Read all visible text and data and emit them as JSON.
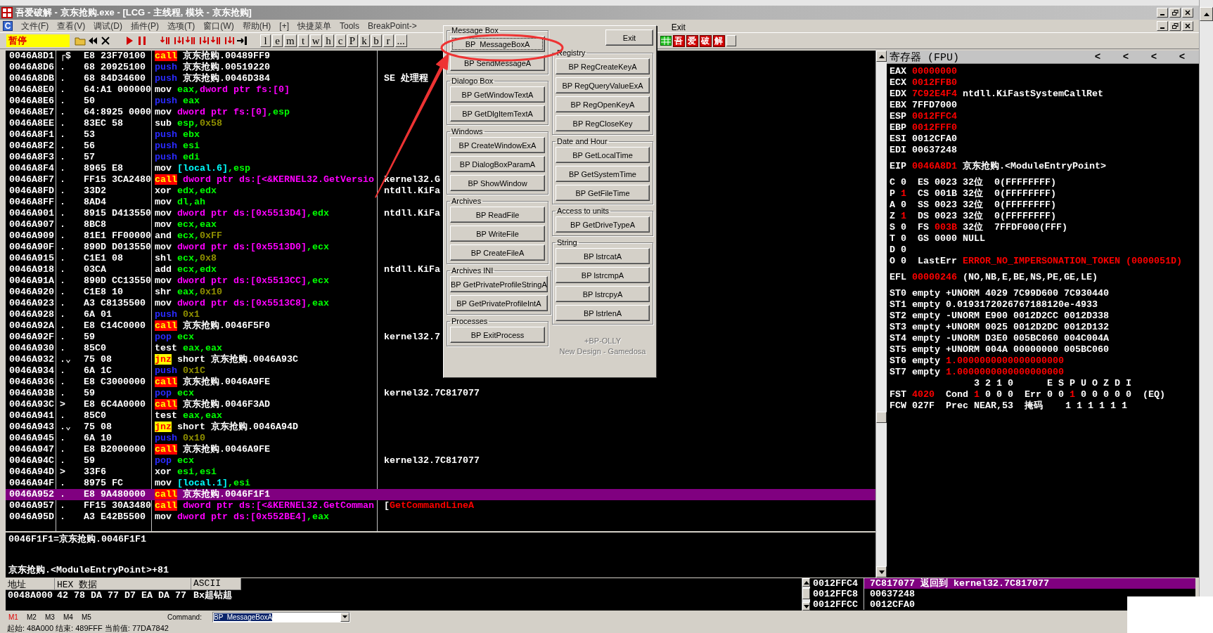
{
  "window": {
    "title": "吾爱破解 - 京东抢购.exe - [LCG - 主线程, 模块 - 京东抢购]"
  },
  "menu": {
    "logo": "C",
    "items": [
      "文件(F)",
      "查看(V)",
      "调试(D)",
      "插件(P)",
      "选项(T)",
      "窗口(W)",
      "帮助(H)",
      "[+]",
      "快捷菜单",
      "Tools",
      "BreakPoint->"
    ],
    "exit": "Exit"
  },
  "toolbar": {
    "state": "暂停",
    "letter_buttons": [
      "l",
      "e",
      "m",
      "t",
      "w",
      "h",
      "c",
      "P",
      "k",
      "b",
      "r",
      "..."
    ],
    "logo_buttons": [
      "吾",
      "爱",
      "破",
      "解"
    ]
  },
  "disassembly": {
    "rows": [
      {
        "address": "0046A8D1",
        "mark": "┌$",
        "bytes": "E8 23F70100",
        "instruction": [
          {
            "text": "call",
            "kind": "call"
          },
          {
            "text": "京东抢购.00489FF9",
            "kind": "sym"
          }
        ],
        "selected": false
      },
      {
        "address": "0046A8D6",
        "mark": ".",
        "bytes": "68 20925100",
        "instruction": [
          {
            "text": "push",
            "kind": "stack"
          },
          {
            "text": "京东抢购.00519220",
            "kind": "sym"
          }
        ],
        "selected": false
      },
      {
        "address": "0046A8DB",
        "mark": ".",
        "bytes": "68 84D34600",
        "instruction": [
          {
            "text": "push",
            "kind": "stack"
          },
          {
            "text": "京东抢购.0046D384",
            "kind": "sym"
          }
        ],
        "comment": [
          {
            "text": "SE 处理程",
            "kind": "text"
          }
        ],
        "selected": false
      },
      {
        "address": "0046A8E0",
        "mark": ".",
        "bytes": "64:A1 000000",
        "instruction": [
          {
            "text": "mov",
            "kind": "op"
          },
          {
            "text": "eax,",
            "kind": "reg"
          },
          {
            "text": "dword ptr fs:[0]",
            "kind": "mem"
          }
        ],
        "selected": false
      },
      {
        "address": "0046A8E6",
        "mark": ".",
        "bytes": "50",
        "instruction": [
          {
            "text": "push",
            "kind": "stack"
          },
          {
            "text": "eax",
            "kind": "reg"
          }
        ],
        "selected": false
      },
      {
        "address": "0046A8E7",
        "mark": ".",
        "bytes": "64:8925 0000",
        "instruction": [
          {
            "text": "mov",
            "kind": "op"
          },
          {
            "text": "dword ptr fs:[0]",
            "kind": "mem"
          },
          {
            "text": ",esp",
            "kind": "reg"
          }
        ],
        "selected": false
      },
      {
        "address": "0046A8EE",
        "mark": ".",
        "bytes": "83EC 58",
        "instruction": [
          {
            "text": "sub",
            "kind": "op"
          },
          {
            "text": "esp,",
            "kind": "reg"
          },
          {
            "text": "0x58",
            "kind": "imm"
          }
        ],
        "selected": false
      },
      {
        "address": "0046A8F1",
        "mark": ".",
        "bytes": "53",
        "instruction": [
          {
            "text": "push",
            "kind": "stack"
          },
          {
            "text": "ebx",
            "kind": "reg"
          }
        ],
        "selected": false
      },
      {
        "address": "0046A8F2",
        "mark": ".",
        "bytes": "56",
        "instruction": [
          {
            "text": "push",
            "kind": "stack"
          },
          {
            "text": "esi",
            "kind": "reg"
          }
        ],
        "selected": false
      },
      {
        "address": "0046A8F3",
        "mark": ".",
        "bytes": "57",
        "instruction": [
          {
            "text": "push",
            "kind": "stack"
          },
          {
            "text": "edi",
            "kind": "reg"
          }
        ],
        "selected": false
      },
      {
        "address": "0046A8F4",
        "mark": ".",
        "bytes": "8965 E8",
        "instruction": [
          {
            "text": "mov",
            "kind": "op"
          },
          {
            "text": "[local.6]",
            "kind": "local"
          },
          {
            "text": ",esp",
            "kind": "reg"
          }
        ],
        "selected": false
      },
      {
        "address": "0046A8F7",
        "mark": ".",
        "bytes": "FF15 3CA2480",
        "instruction": [
          {
            "text": "call",
            "kind": "call"
          },
          {
            "text": "dword ptr ds:[<&KERNEL32.GetVersio",
            "kind": "mem"
          }
        ],
        "comment": [
          {
            "text": "kernel32.G",
            "kind": "text"
          }
        ],
        "selected": false
      },
      {
        "address": "0046A8FD",
        "mark": ".",
        "bytes": "33D2",
        "instruction": [
          {
            "text": "xor",
            "kind": "op"
          },
          {
            "text": "edx,edx",
            "kind": "reg"
          }
        ],
        "comment": [
          {
            "text": "ntdll.KiFa",
            "kind": "text"
          }
        ],
        "selected": false
      },
      {
        "address": "0046A8FF",
        "mark": ".",
        "bytes": "8AD4",
        "instruction": [
          {
            "text": "mov",
            "kind": "op"
          },
          {
            "text": "dl,ah",
            "kind": "reg"
          }
        ],
        "selected": false
      },
      {
        "address": "0046A901",
        "mark": ".",
        "bytes": "8915 D413550",
        "instruction": [
          {
            "text": "mov",
            "kind": "op"
          },
          {
            "text": "dword ptr ds:[0x5513D4]",
            "kind": "mem"
          },
          {
            "text": ",edx",
            "kind": "reg"
          }
        ],
        "comment": [
          {
            "text": "ntdll.KiFa",
            "kind": "text"
          }
        ],
        "selected": false
      },
      {
        "address": "0046A907",
        "mark": ".",
        "bytes": "8BC8",
        "instruction": [
          {
            "text": "mov",
            "kind": "op"
          },
          {
            "text": "ecx,eax",
            "kind": "reg"
          }
        ],
        "selected": false
      },
      {
        "address": "0046A909",
        "mark": ".",
        "bytes": "81E1 FF00000",
        "instruction": [
          {
            "text": "and",
            "kind": "op"
          },
          {
            "text": "ecx,",
            "kind": "reg"
          },
          {
            "text": "0xFF",
            "kind": "imm"
          }
        ],
        "selected": false
      },
      {
        "address": "0046A90F",
        "mark": ".",
        "bytes": "890D D013550",
        "instruction": [
          {
            "text": "mov",
            "kind": "op"
          },
          {
            "text": "dword ptr ds:[0x5513D0]",
            "kind": "mem"
          },
          {
            "text": ",ecx",
            "kind": "reg"
          }
        ],
        "selected": false
      },
      {
        "address": "0046A915",
        "mark": ".",
        "bytes": "C1E1 08",
        "instruction": [
          {
            "text": "shl",
            "kind": "op"
          },
          {
            "text": "ecx,",
            "kind": "reg"
          },
          {
            "text": "0x8",
            "kind": "imm"
          }
        ],
        "selected": false
      },
      {
        "address": "0046A918",
        "mark": ".",
        "bytes": "03CA",
        "instruction": [
          {
            "text": "add",
            "kind": "op"
          },
          {
            "text": "ecx,edx",
            "kind": "reg"
          }
        ],
        "comment": [
          {
            "text": "ntdll.KiFa",
            "kind": "text"
          }
        ],
        "selected": false
      },
      {
        "address": "0046A91A",
        "mark": ".",
        "bytes": "890D CC13550",
        "instruction": [
          {
            "text": "mov",
            "kind": "op"
          },
          {
            "text": "dword ptr ds:[0x5513CC]",
            "kind": "mem"
          },
          {
            "text": ",ecx",
            "kind": "reg"
          }
        ],
        "selected": false
      },
      {
        "address": "0046A920",
        "mark": ".",
        "bytes": "C1E8 10",
        "instruction": [
          {
            "text": "shr",
            "kind": "op"
          },
          {
            "text": "eax,",
            "kind": "reg"
          },
          {
            "text": "0x10",
            "kind": "imm"
          }
        ],
        "selected": false
      },
      {
        "address": "0046A923",
        "mark": ".",
        "bytes": "A3 C8135500",
        "instruction": [
          {
            "text": "mov",
            "kind": "op"
          },
          {
            "text": "dword ptr ds:[0x5513C8]",
            "kind": "mem"
          },
          {
            "text": ",eax",
            "kind": "reg"
          }
        ],
        "selected": false
      },
      {
        "address": "0046A928",
        "mark": ".",
        "bytes": "6A 01",
        "instruction": [
          {
            "text": "push",
            "kind": "stack"
          },
          {
            "text": "0x1",
            "kind": "imm"
          }
        ],
        "selected": false
      },
      {
        "address": "0046A92A",
        "mark": ".",
        "bytes": "E8 C14C0000",
        "instruction": [
          {
            "text": "call",
            "kind": "call"
          },
          {
            "text": "京东抢购.0046F5F0",
            "kind": "sym"
          }
        ],
        "selected": false
      },
      {
        "address": "0046A92F",
        "mark": ".",
        "bytes": "59",
        "instruction": [
          {
            "text": "pop",
            "kind": "stack"
          },
          {
            "text": "ecx",
            "kind": "reg"
          }
        ],
        "comment": [
          {
            "text": "kernel32.7",
            "kind": "text"
          }
        ],
        "selected": false
      },
      {
        "address": "0046A930",
        "mark": ".",
        "bytes": "85C0",
        "instruction": [
          {
            "text": "test",
            "kind": "op"
          },
          {
            "text": "eax,eax",
            "kind": "reg"
          }
        ],
        "selected": false
      },
      {
        "address": "0046A932",
        "mark": ".⌄",
        "bytes": "75 08",
        "instruction": [
          {
            "text": "jnz",
            "kind": "jump"
          },
          {
            "text": "short 京东抢购.0046A93C",
            "kind": "sym"
          }
        ],
        "selected": false
      },
      {
        "address": "0046A934",
        "mark": ".",
        "bytes": "6A 1C",
        "instruction": [
          {
            "text": "push",
            "kind": "stack"
          },
          {
            "text": "0x1C",
            "kind": "imm"
          }
        ],
        "selected": false
      },
      {
        "address": "0046A936",
        "mark": ".",
        "bytes": "E8 C3000000",
        "instruction": [
          {
            "text": "call",
            "kind": "call"
          },
          {
            "text": "京东抢购.0046A9FE",
            "kind": "sym"
          }
        ],
        "selected": false
      },
      {
        "address": "0046A93B",
        "mark": ".",
        "bytes": "59",
        "instruction": [
          {
            "text": "pop",
            "kind": "stack"
          },
          {
            "text": "ecx",
            "kind": "reg"
          }
        ],
        "comment": [
          {
            "text": "kernel32.7C817077",
            "kind": "text"
          }
        ],
        "selected": false
      },
      {
        "address": "0046A93C",
        "mark": ">",
        "bytes": "E8 6C4A0000",
        "instruction": [
          {
            "text": "call",
            "kind": "call"
          },
          {
            "text": "京东抢购.0046F3AD",
            "kind": "sym"
          }
        ],
        "selected": false
      },
      {
        "address": "0046A941",
        "mark": ".",
        "bytes": "85C0",
        "instruction": [
          {
            "text": "test",
            "kind": "op"
          },
          {
            "text": "eax,eax",
            "kind": "reg"
          }
        ],
        "selected": false
      },
      {
        "address": "0046A943",
        "mark": ".⌄",
        "bytes": "75 08",
        "instruction": [
          {
            "text": "jnz",
            "kind": "jump"
          },
          {
            "text": "short 京东抢购.0046A94D",
            "kind": "sym"
          }
        ],
        "selected": false
      },
      {
        "address": "0046A945",
        "mark": ".",
        "bytes": "6A 10",
        "instruction": [
          {
            "text": "push",
            "kind": "stack"
          },
          {
            "text": "0x10",
            "kind": "imm"
          }
        ],
        "selected": false
      },
      {
        "address": "0046A947",
        "mark": ".",
        "bytes": "E8 B2000000",
        "instruction": [
          {
            "text": "call",
            "kind": "call"
          },
          {
            "text": "京东抢购.0046A9FE",
            "kind": "sym"
          }
        ],
        "selected": false
      },
      {
        "address": "0046A94C",
        "mark": ".",
        "bytes": "59",
        "instruction": [
          {
            "text": "pop",
            "kind": "stack"
          },
          {
            "text": "ecx",
            "kind": "reg"
          }
        ],
        "comment": [
          {
            "text": "kernel32.7C817077",
            "kind": "text"
          }
        ],
        "selected": false
      },
      {
        "address": "0046A94D",
        "mark": ">",
        "bytes": "33F6",
        "instruction": [
          {
            "text": "xor",
            "kind": "op"
          },
          {
            "text": "esi,esi",
            "kind": "reg"
          }
        ],
        "selected": false
      },
      {
        "address": "0046A94F",
        "mark": ".",
        "bytes": "8975 FC",
        "instruction": [
          {
            "text": "mov",
            "kind": "op"
          },
          {
            "text": "[local.1]",
            "kind": "local"
          },
          {
            "text": ",esi",
            "kind": "reg"
          }
        ],
        "selected": false
      },
      {
        "address": "0046A952",
        "mark": ".",
        "bytes": "E8 9A480000",
        "instruction": [
          {
            "text": "call",
            "kind": "call"
          },
          {
            "text": "京东抢购.0046F1F1",
            "kind": "sym"
          }
        ],
        "selected": true
      },
      {
        "address": "0046A957",
        "mark": ".",
        "bytes": "FF15 30A3480",
        "instruction": [
          {
            "text": "call",
            "kind": "call"
          },
          {
            "text": "dword ptr ds:[<&KERNEL32.GetComman",
            "kind": "mem"
          }
        ],
        "comment": [
          {
            "text": "[",
            "kind": "text"
          },
          {
            "text": "GetCommandLineA",
            "kind": "api"
          }
        ],
        "selected": false
      },
      {
        "address": "0046A95D",
        "mark": ".",
        "bytes": "A3 E42B5500",
        "instruction": [
          {
            "text": "mov",
            "kind": "op"
          },
          {
            "text": "dword ptr ds:[0x552BE4]",
            "kind": "mem"
          },
          {
            "text": ",eax",
            "kind": "reg"
          }
        ],
        "selected": false
      }
    ]
  },
  "info": {
    "lines": [
      "0046F1F1=京东抢购.0046F1F1",
      "京东抢购.<ModuleEntryPoint>+81"
    ]
  },
  "registers": {
    "title": "寄存器 (FPU)",
    "nav_buttons": [
      "<",
      "<",
      "<",
      "<"
    ],
    "groups": [
      [
        [
          {
            "text": "EAX ",
            "changed": false
          },
          {
            "text": "00000000",
            "changed": true
          }
        ],
        [
          {
            "text": "ECX ",
            "changed": false
          },
          {
            "text": "0012FFB0",
            "changed": true
          }
        ],
        [
          {
            "text": "EDX ",
            "changed": false
          },
          {
            "text": "7C92E4F4",
            "changed": true
          },
          {
            "text": " ntdll.KiFastSystemCallRet",
            "changed": false
          }
        ],
        [
          {
            "text": "EBX 7FFD7000",
            "changed": false
          }
        ],
        [
          {
            "text": "ESP ",
            "changed": false
          },
          {
            "text": "0012FFC4",
            "changed": true
          }
        ],
        [
          {
            "text": "EBP ",
            "changed": false
          },
          {
            "text": "0012FFF0",
            "changed": true
          }
        ],
        [
          {
            "text": "ESI 0012CFA0",
            "changed": false
          }
        ],
        [
          {
            "text": "EDI 00637248",
            "changed": false
          }
        ]
      ],
      [
        [
          {
            "text": "EIP ",
            "changed": false
          },
          {
            "text": "0046A8D1",
            "changed": true
          },
          {
            "text": " 京东抢购.<ModuleEntryPoint>",
            "changed": false
          }
        ]
      ],
      [
        [
          {
            "text": "C 0  ES 0023 32位  0(FFFFFFFF)",
            "changed": false
          }
        ],
        [
          {
            "text": "P ",
            "changed": false
          },
          {
            "text": "1",
            "changed": true
          },
          {
            "text": "  CS 001B 32位  0(FFFFFFFF)",
            "changed": false
          }
        ],
        [
          {
            "text": "A 0  SS 0023 32位  0(FFFFFFFF)",
            "changed": false
          }
        ],
        [
          {
            "text": "Z ",
            "changed": false
          },
          {
            "text": "1",
            "changed": true
          },
          {
            "text": "  DS 0023 32位  0(FFFFFFFF)",
            "changed": false
          }
        ],
        [
          {
            "text": "S 0  FS ",
            "changed": false
          },
          {
            "text": "003B",
            "changed": true
          },
          {
            "text": " 32位  7FFDF000(FFF)",
            "changed": false
          }
        ],
        [
          {
            "text": "T 0  GS 0000 NULL",
            "changed": false
          }
        ],
        [
          {
            "text": "D 0",
            "changed": false
          }
        ],
        [
          {
            "text": "O 0  LastErr ",
            "changed": false
          },
          {
            "text": "ERROR_NO_IMPERSONATION_TOKEN (0000051D)",
            "changed": true
          }
        ]
      ],
      [
        [
          {
            "text": "EFL ",
            "changed": false
          },
          {
            "text": "00000246",
            "changed": true
          },
          {
            "text": " (NO,NB,E,BE,NS,PE,GE,LE)",
            "changed": false
          }
        ]
      ],
      [
        [
          {
            "text": "ST0 empty +UNORM 4029 7C99D600 7C930440",
            "changed": false
          }
        ],
        [
          {
            "text": "ST1 empty 0.0193172026767188120e-4933",
            "changed": false
          }
        ],
        [
          {
            "text": "ST2 empty -UNORM E900 0012D2CC 0012D338",
            "changed": false
          }
        ],
        [
          {
            "text": "ST3 empty +UNORM 0025 0012D2DC 0012D132",
            "changed": false
          }
        ],
        [
          {
            "text": "ST4 empty -UNORM D3E0 005BC060 004C004A",
            "changed": false
          }
        ],
        [
          {
            "text": "ST5 empty +UNORM 004A 00000000 005BC060",
            "changed": false
          }
        ],
        [
          {
            "text": "ST6 empty ",
            "changed": false
          },
          {
            "text": "1.0000000000000000000",
            "changed": true
          }
        ],
        [
          {
            "text": "ST7 empty ",
            "changed": false
          },
          {
            "text": "1.0000000000000000000",
            "changed": true
          }
        ],
        [
          {
            "text": "               3 2 1 0      E S P U O Z D I",
            "changed": false
          }
        ],
        [
          {
            "text": "FST ",
            "changed": false
          },
          {
            "text": "4020",
            "changed": true
          },
          {
            "text": "  Cond ",
            "changed": false
          },
          {
            "text": "1",
            "changed": true
          },
          {
            "text": " 0 0 0  Err 0 0 ",
            "changed": false
          },
          {
            "text": "1",
            "changed": true
          },
          {
            "text": " 0 0 0 0 0  (EQ)",
            "changed": false
          }
        ],
        [
          {
            "text": "FCW 027F  Prec NEAR,53  掩码    1 1 1 1 1 1",
            "changed": false
          }
        ]
      ]
    ]
  },
  "dump": {
    "columns": [
      "地址",
      "HEX 数据",
      "ASCII"
    ],
    "rows": [
      {
        "address": "0048A000",
        "hex": "42 78 DA 77 D7 EA DA 77",
        "ascii": "Bx趄钻趄"
      }
    ]
  },
  "stack": {
    "rows": [
      {
        "address": "0012FFC4",
        "value": "7C817077",
        "comment": "返回到 kernel32.7C817077",
        "selected": true
      },
      {
        "address": "0012FFC8",
        "value": "00637248",
        "selected": false
      },
      {
        "address": "0012FFCC",
        "value": "0012CFA0",
        "selected": false
      }
    ]
  },
  "command_bar": {
    "marks": [
      {
        "label": "M1",
        "selected": true
      },
      {
        "label": "M2",
        "selected": false
      },
      {
        "label": "M3",
        "selected": false
      },
      {
        "label": "M4",
        "selected": false
      },
      {
        "label": "M5",
        "selected": false
      }
    ],
    "label": "Command:",
    "value": "BP  MessageBoxA"
  },
  "status_bar": "起始: 48A000 结束: 489FFF 当前值: 77DA7842",
  "bp_dialog": {
    "exit": "Exit",
    "left": [
      {
        "title": "Message Box",
        "buttons": [
          {
            "label": "BP  MessageBoxA",
            "focused": true
          },
          {
            "label": "BP SendMessageA",
            "focused": false
          }
        ]
      },
      {
        "title": "Dialogo Box",
        "buttons": [
          {
            "label": "BP GetWindowTextA",
            "focused": false
          },
          {
            "label": "BP GetDlgItemTextA",
            "focused": false
          }
        ]
      },
      {
        "title": "Windows",
        "buttons": [
          {
            "label": "BP CreateWindowExA",
            "focused": false
          },
          {
            "label": "BP DialogBoxParamA",
            "focused": false
          },
          {
            "label": "BP ShowWindow",
            "focused": false
          }
        ]
      },
      {
        "title": "Archives",
        "buttons": [
          {
            "label": "BP ReadFile",
            "focused": false
          },
          {
            "label": "BP WriteFile",
            "focused": false
          },
          {
            "label": "BP CreateFileA",
            "focused": false
          }
        ]
      },
      {
        "title": "Archives INI",
        "buttons": [
          {
            "label": "BP GetPrivateProfileStringA",
            "focused": false
          },
          {
            "label": "BP GetPrivateProfileIntA",
            "focused": false
          }
        ]
      },
      {
        "title": "Processes",
        "buttons": [
          {
            "label": "BP ExitProcess",
            "focused": false
          }
        ]
      }
    ],
    "right": [
      {
        "title": "Registry",
        "buttons": [
          {
            "label": "BP RegCreateKeyA",
            "focused": false
          },
          {
            "label": "BP RegQueryValueExA",
            "focused": false
          },
          {
            "label": "BP RegOpenKeyA",
            "focused": false
          },
          {
            "label": "BP RegCloseKey",
            "focused": false
          }
        ]
      },
      {
        "title": "Date and Hour",
        "buttons": [
          {
            "label": "BP GetLocalTime",
            "focused": false
          },
          {
            "label": "BP GetSystemTime",
            "focused": false
          },
          {
            "label": "BP GetFileTime",
            "focused": false
          }
        ]
      },
      {
        "title": "Access to units",
        "buttons": [
          {
            "label": "BP GetDriveTypeA",
            "focused": false
          }
        ]
      },
      {
        "title": "String",
        "buttons": [
          {
            "label": "BP lstrcatA",
            "focused": false
          },
          {
            "label": "BP lstrcmpA",
            "focused": false
          },
          {
            "label": "BP lstrcpyA",
            "focused": false
          },
          {
            "label": "BP lstrlenA",
            "focused": false
          }
        ]
      }
    ],
    "credits": [
      "+BP-OLLY",
      "New Design - Gamedosa"
    ]
  }
}
